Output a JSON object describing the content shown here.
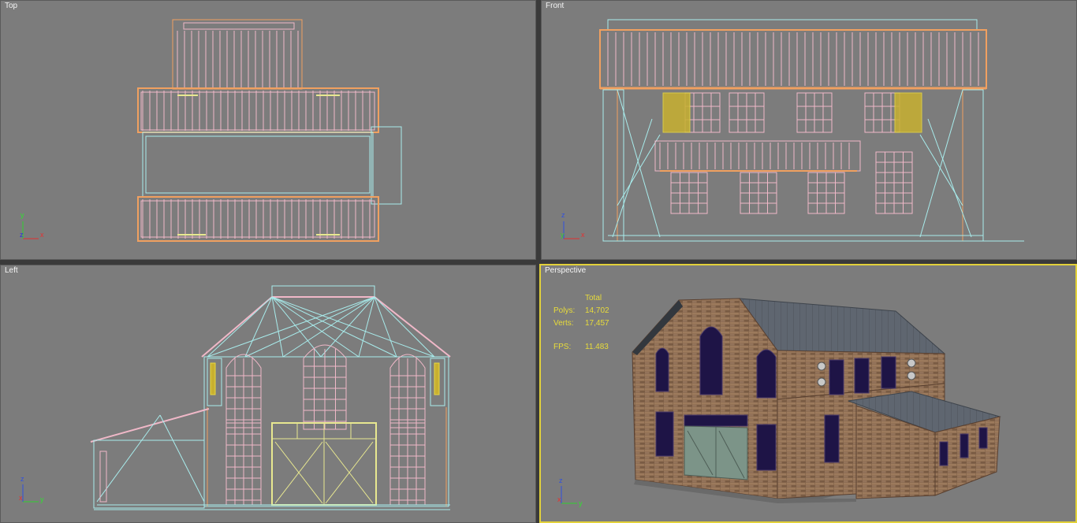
{
  "viewports": {
    "top": {
      "label": "Top",
      "axes": {
        "up": "y",
        "right": "x",
        "center": "z"
      }
    },
    "front": {
      "label": "Front",
      "axes": {
        "up": "z",
        "right": "x",
        "center": "y"
      }
    },
    "left": {
      "label": "Left",
      "axes": {
        "up": "z",
        "right": "y",
        "center": "x"
      }
    },
    "perspective": {
      "label": "Perspective",
      "axes": {
        "up": "z",
        "right": "y",
        "center": "x"
      },
      "stats": {
        "header": "Total",
        "polys_label": "Polys:",
        "polys": "14,702",
        "verts_label": "Verts:",
        "verts": "17,457",
        "fps_label": "FPS:",
        "fps": "11.483"
      }
    }
  },
  "colors": {
    "viewport_bg": "#7c7c7c",
    "active_border": "#e2d13a",
    "wire_pink": "#f0b8c8",
    "wire_orange": "#f0a060",
    "wire_cyan": "#a8ecec",
    "wire_yellow": "#e8e890",
    "stats_text": "#e8dc3a"
  }
}
